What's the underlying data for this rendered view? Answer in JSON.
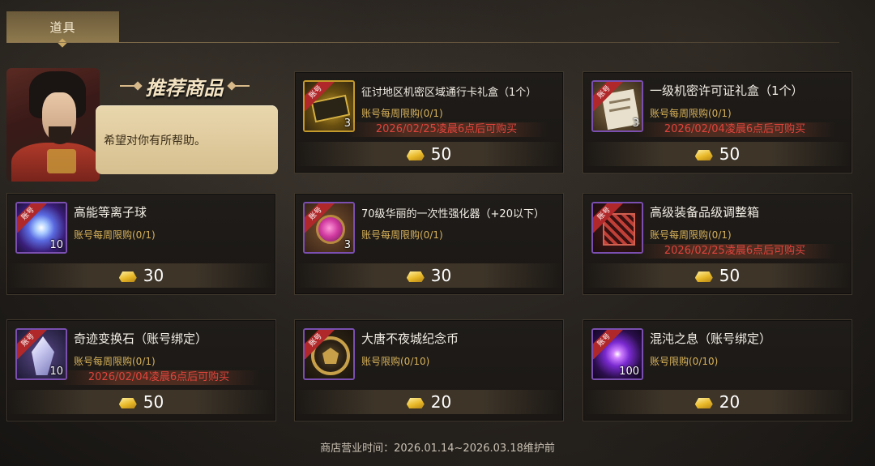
{
  "tab": {
    "label": "道具"
  },
  "recommend": {
    "title": "推荐商品",
    "message": "希望对你有所帮助。"
  },
  "badge_text": "账号",
  "items": [
    {
      "name": "征讨地区机密区域通行卡礼盒（1个）",
      "limit": "账号每周限购(0/1)",
      "notice": "2026/02/25凌晨6点后可购买",
      "qty": "3",
      "price": "50",
      "icon": "pass-card-icon"
    },
    {
      "name": "一级机密许可证礼盒（1个）",
      "limit": "账号每周限购(0/1)",
      "notice": "2026/02/04凌晨6点后可购买",
      "qty": "3",
      "price": "50",
      "icon": "certificate-icon"
    },
    {
      "name": "高能等离子球",
      "limit": "账号每周限购(0/1)",
      "notice": "",
      "qty": "10",
      "price": "30",
      "icon": "plasma-orb-icon"
    },
    {
      "name": "70级华丽的一次性强化器（+20以下）",
      "limit": "账号每周限购(0/1)",
      "notice": "",
      "qty": "3",
      "price": "30",
      "icon": "enhancer-icon"
    },
    {
      "name": "高级装备品级调整箱",
      "limit": "账号每周限购(0/1)",
      "notice": "2026/02/25凌晨6点后可购买",
      "qty": "",
      "price": "50",
      "icon": "equipment-box-icon"
    },
    {
      "name": "奇迹变换石（账号绑定）",
      "limit": "账号每周限购(0/1)",
      "notice": "2026/02/04凌晨6点后可购买",
      "qty": "10",
      "price": "50",
      "icon": "crystal-icon"
    },
    {
      "name": "大唐不夜城纪念币",
      "limit": "账号限购(0/10)",
      "notice": "",
      "qty": "",
      "price": "20",
      "icon": "coin-icon"
    },
    {
      "name": "混沌之息（账号绑定）",
      "limit": "账号限购(0/10)",
      "notice": "",
      "qty": "100",
      "price": "20",
      "icon": "chaos-breath-icon"
    }
  ],
  "footer": "商店营业时间：2026.01.14~2026.03.18维护前"
}
